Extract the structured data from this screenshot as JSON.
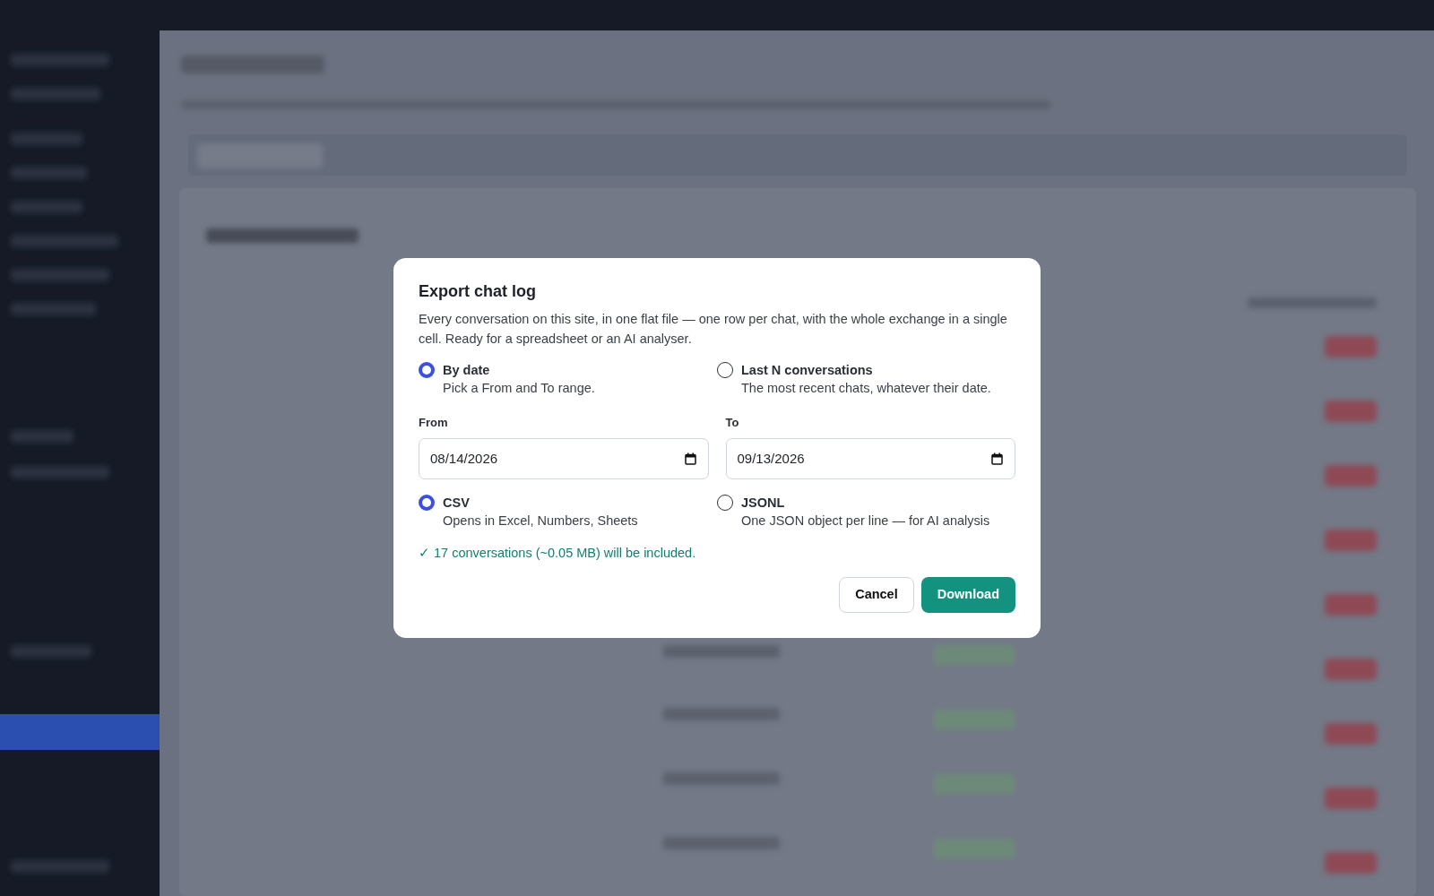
{
  "dialog": {
    "title": "Export chat log",
    "description": "Every conversation on this site, in one flat file — one row per chat, with the whole exchange in a single cell. Ready for a spreadsheet or an AI analyser.",
    "range_options": [
      {
        "label": "By date",
        "hint": "Pick a From and To range.",
        "selected": true
      },
      {
        "label": "Last N conversations",
        "hint": "The most recent chats, whatever their date.",
        "selected": false
      }
    ],
    "date_fields": [
      {
        "label": "From",
        "value": "08/14/2026"
      },
      {
        "label": "To",
        "value": "09/13/2026"
      }
    ],
    "format_options": [
      {
        "label": "CSV",
        "hint": "Opens in Excel, Numbers, Sheets",
        "selected": true
      },
      {
        "label": "JSONL",
        "hint": "One JSON object per line — for AI analysis",
        "selected": false
      }
    ],
    "summary": "✓ 17 conversations (~0.05 MB) will be included.",
    "buttons": [
      {
        "label": "Cancel",
        "kind": "secondary"
      },
      {
        "label": "Download",
        "kind": "primary"
      }
    ]
  }
}
